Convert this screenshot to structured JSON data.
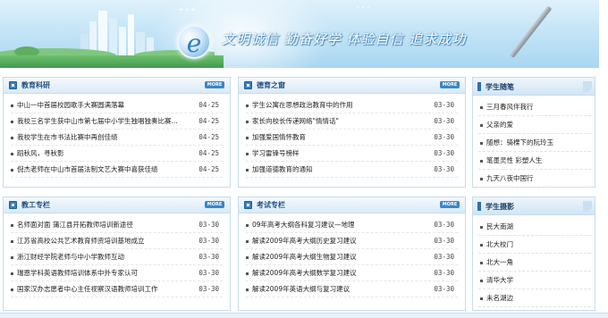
{
  "banner": {
    "slogan": "文明诚信 勤奋好学 体验自信 追求成功",
    "logo_letter": "e"
  },
  "more_label": "MORE",
  "panels": [
    {
      "title": "教育科研",
      "items": [
        {
          "text": "中山一中首届校园歌手大赛圆满落幕",
          "date": "04-25"
        },
        {
          "text": "我校三名学生获中山市第七届中小学生独唱独奏比赛...",
          "date": "04-25"
        },
        {
          "text": "我校学生在市书法比赛中再创佳绩",
          "date": "04-25"
        },
        {
          "text": "蹈秋风，寻秋影",
          "date": "04-25"
        },
        {
          "text": "倪杰老师在中山市首届法制文艺大赛中喜获佳绩",
          "date": "04-25"
        }
      ]
    },
    {
      "title": "德育之窗",
      "items": [
        {
          "text": "学生公寓在思想政治教育中的作用",
          "date": "03-30"
        },
        {
          "text": "家长向校长传递网络\"情情话\"",
          "date": "03-30"
        },
        {
          "text": "加强爱国情怀教育",
          "date": "03-30"
        },
        {
          "text": "学习雷锋号榜样",
          "date": "03-30"
        },
        {
          "text": "加强道德教育的通知",
          "date": "03-30"
        }
      ]
    },
    {
      "title": "教工专栏",
      "items": [
        {
          "text": "名师面对面 蒲江县开拓教师培训新途径",
          "date": "03-30"
        },
        {
          "text": "江苏省高校公共艺术教育师资培训基地成立",
          "date": "03-30"
        },
        {
          "text": "浙江财经学院老师与中小学教师互动",
          "date": "03-30"
        },
        {
          "text": "瑞恩学科英语教师培训体系中外专家认可",
          "date": "03-30"
        },
        {
          "text": "国家汉办志愿者中心主任视察汉语教师培训工作",
          "date": "03-30"
        }
      ]
    },
    {
      "title": "考试专栏",
      "items": [
        {
          "text": "09年高考大纲各科复习建议—地理",
          "date": "03-30"
        },
        {
          "text": "解读2009年高考大纲历史复习建议",
          "date": "03-30"
        },
        {
          "text": "解读2009年高考大纲生物复习建议",
          "date": "03-30"
        },
        {
          "text": "解读2009年高考大纲数学复习建议",
          "date": "03-30"
        },
        {
          "text": "解读2009年英语大纲与复习建议",
          "date": "03-30"
        }
      ]
    }
  ],
  "sidebars": [
    {
      "title": "学生随笔",
      "items": [
        "三月春风伴我行",
        "父亲的爱",
        "随想：骑棵下的阮玲玉",
        "笔墨灵性 彩塑人生",
        "九天八夜中国行"
      ]
    },
    {
      "title": "学生摄影",
      "items": [
        "民大南湖",
        "北大校门",
        "北大一角",
        "清华大学",
        "未名湖边"
      ]
    }
  ],
  "colors": {
    "accent": "#3a7fc0",
    "panel_border": "#c6dced",
    "title_text": "#1c4e85"
  }
}
